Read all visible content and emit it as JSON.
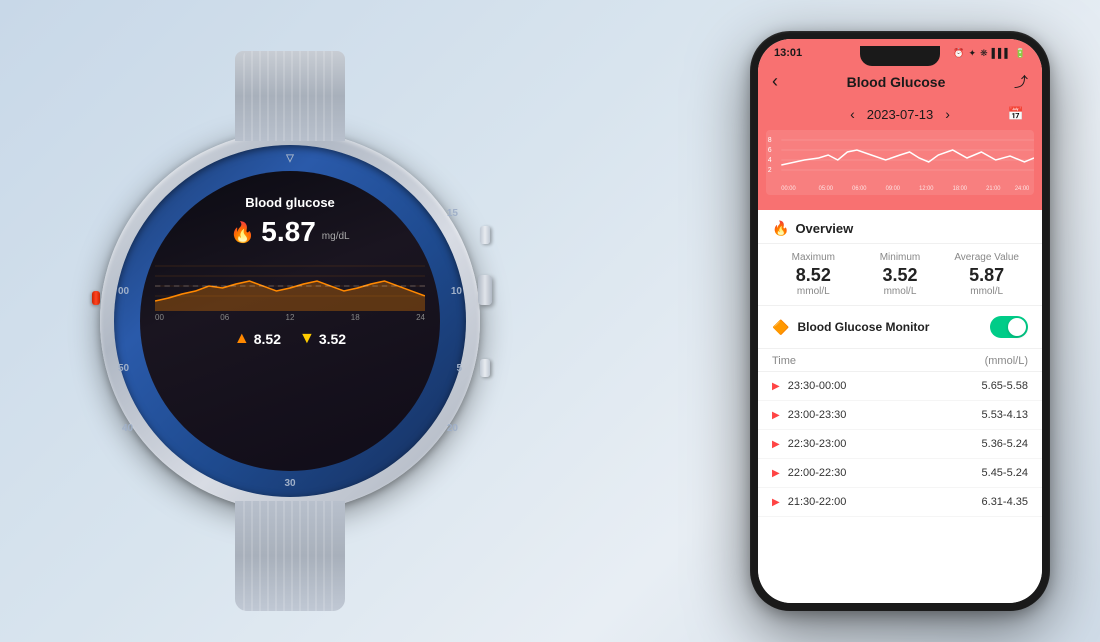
{
  "background": {
    "gradient_start": "#c8d8e8",
    "gradient_end": "#d0dce8"
  },
  "watch": {
    "label": "Blood glucose",
    "value": "5.87",
    "unit": "mg/dL",
    "stats": {
      "max_label": "8.52",
      "min_label": "3.52"
    },
    "time_axis": [
      "00",
      "06",
      "12",
      "18",
      "24"
    ]
  },
  "phone": {
    "status_bar": {
      "time": "13:01",
      "icons": "⏰ ✦ ❋ 📶 🔋"
    },
    "header": {
      "back_icon": "‹",
      "title": "Blood Glucose",
      "share_icon": "⤴"
    },
    "date_nav": {
      "prev_icon": "‹",
      "date": "2023-07-13",
      "next_icon": "›",
      "calendar_icon": "📅"
    },
    "overview": {
      "title": "Overview",
      "flame_icon": "🔥",
      "stats": [
        {
          "label": "Maximum",
          "value": "8.52",
          "unit": "mmol/L"
        },
        {
          "label": "Minimum",
          "value": "3.52",
          "unit": "mmol/L"
        },
        {
          "label": "Average Value",
          "value": "5.87",
          "unit": "mmol/L"
        }
      ]
    },
    "monitor": {
      "icon": "🔶",
      "label": "Blood Glucose Monitor",
      "toggle_on": true
    },
    "table": {
      "col_time": "Time",
      "col_unit": "(mmol/L)",
      "rows": [
        {
          "time": "23:30-00:00",
          "value": "5.65-5.58"
        },
        {
          "time": "23:00-23:30",
          "value": "5.53-4.13"
        },
        {
          "time": "22:30-23:00",
          "value": "5.36-5.24"
        },
        {
          "time": "22:00-22:30",
          "value": "5.45-5.24"
        },
        {
          "time": "21:30-22:00",
          "value": "6.31-4.35"
        }
      ]
    }
  }
}
